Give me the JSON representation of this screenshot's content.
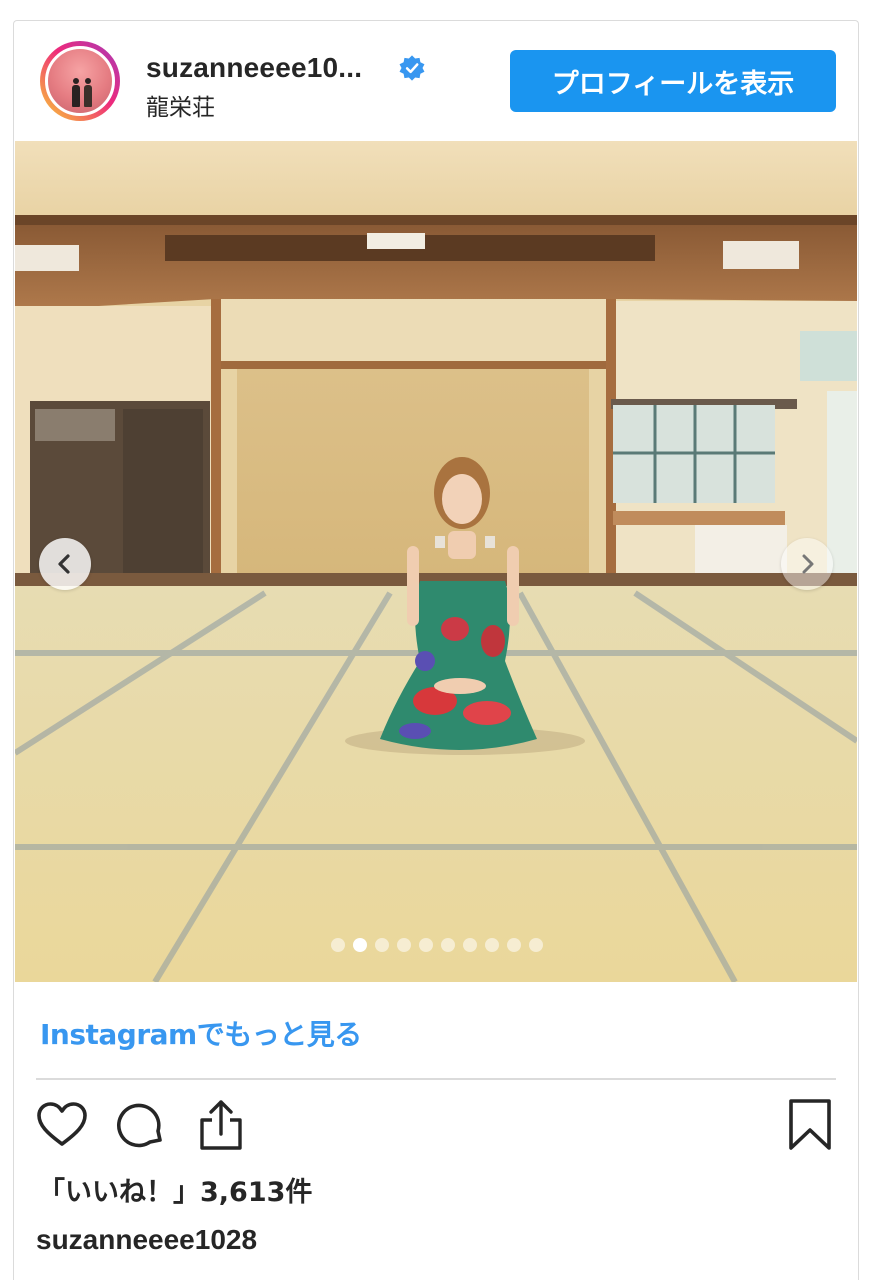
{
  "header": {
    "username": "suzanneeee10...",
    "location": "龍栄荘",
    "profile_button": "プロフィールを表示"
  },
  "post": {
    "image_count": 10,
    "active_image": 2
  },
  "footer": {
    "more_link": "Instagramでもっと見る",
    "likes": "「いいね！」3,613件",
    "owner_username": "suzanneeee1028"
  },
  "icons": {
    "verified": "verified-badge-icon",
    "like": "heart-icon",
    "comment": "comment-icon",
    "share": "share-icon",
    "save": "bookmark-icon",
    "prev": "chevron-left-icon",
    "next": "chevron-right-icon"
  },
  "colors": {
    "accent": "#1a95f0",
    "link": "#3897f0",
    "verified": "#3897f0",
    "text": "#262626",
    "border": "#dbdbdb"
  }
}
